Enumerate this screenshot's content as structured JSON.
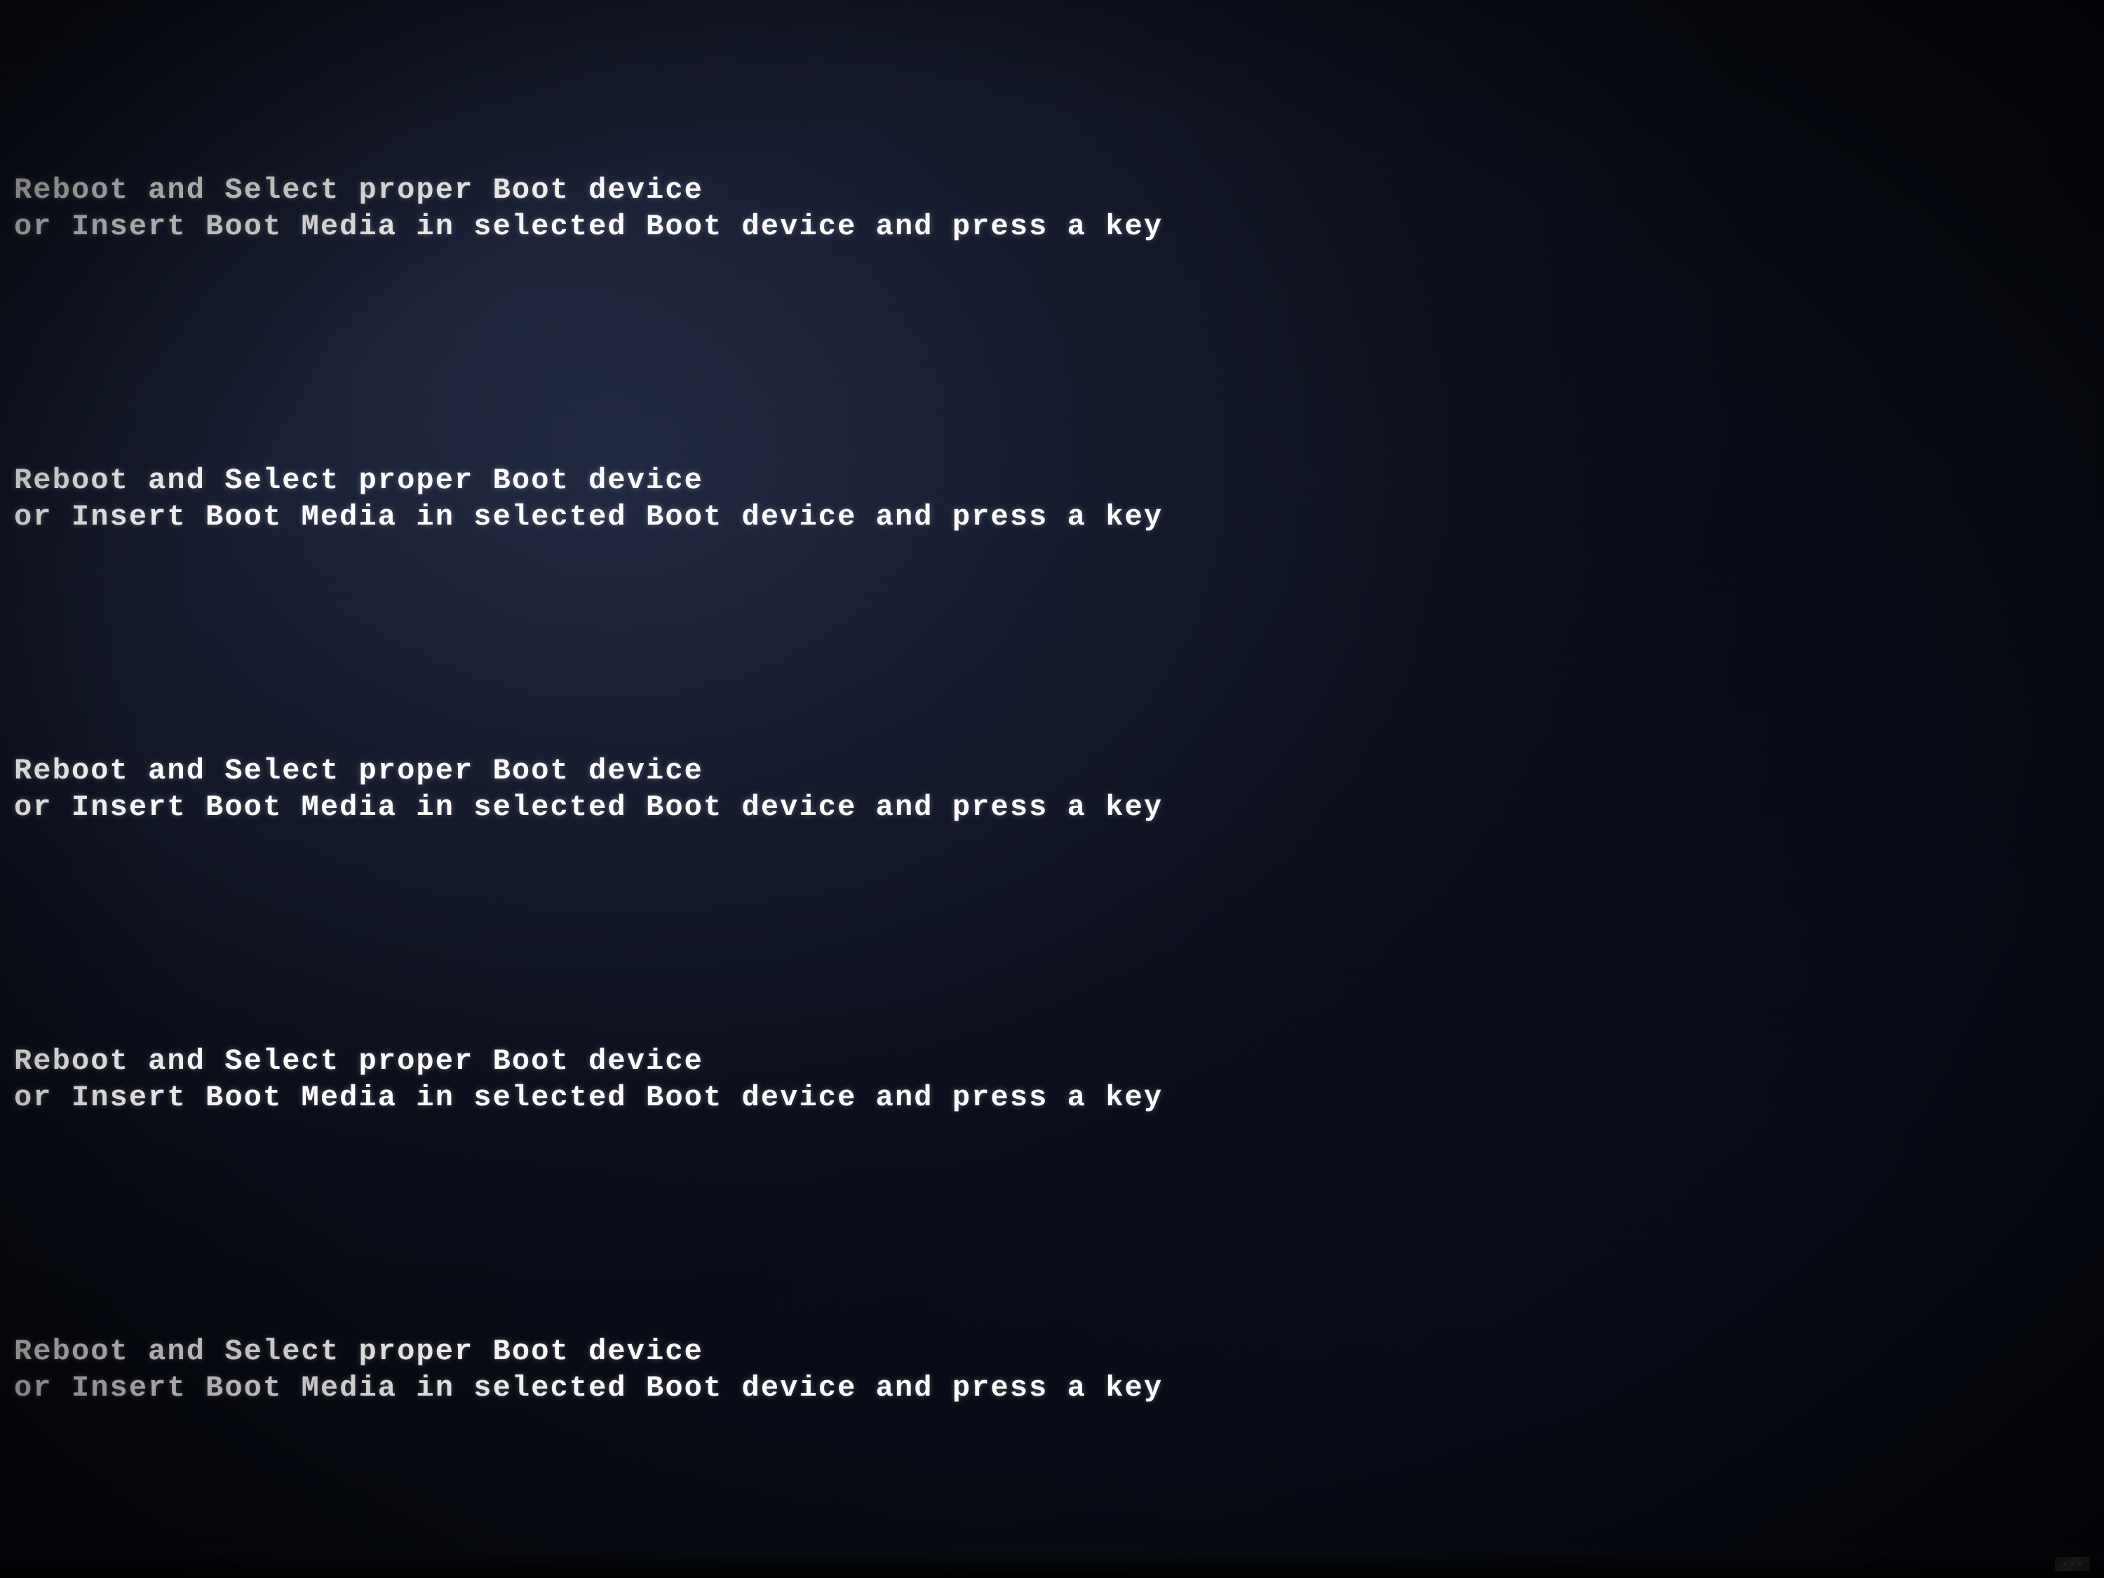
{
  "screen": {
    "background_color": "#0a0d1a",
    "messages": [
      {
        "id": "group1",
        "line1": "Reboot and Select proper Boot device",
        "line2": "or Insert Boot Media in selected Boot device and press a key"
      },
      {
        "id": "group2",
        "line1": "Reboot and Select proper Boot device",
        "line2": "or Insert Boot Media in selected Boot device and press a key"
      },
      {
        "id": "group3",
        "line1": "Reboot and Select proper Boot device",
        "line2": "or Insert Boot Media in selected Boot device and press a key"
      },
      {
        "id": "group4",
        "line1": "Reboot and Select proper Boot device",
        "line2": "or Insert Boot Media in selected Boot device and press a key"
      },
      {
        "id": "group5",
        "line1": "Reboot and Select proper Boot device",
        "line2": "or Insert Boot Media in selected Boot device and press a key"
      }
    ]
  }
}
